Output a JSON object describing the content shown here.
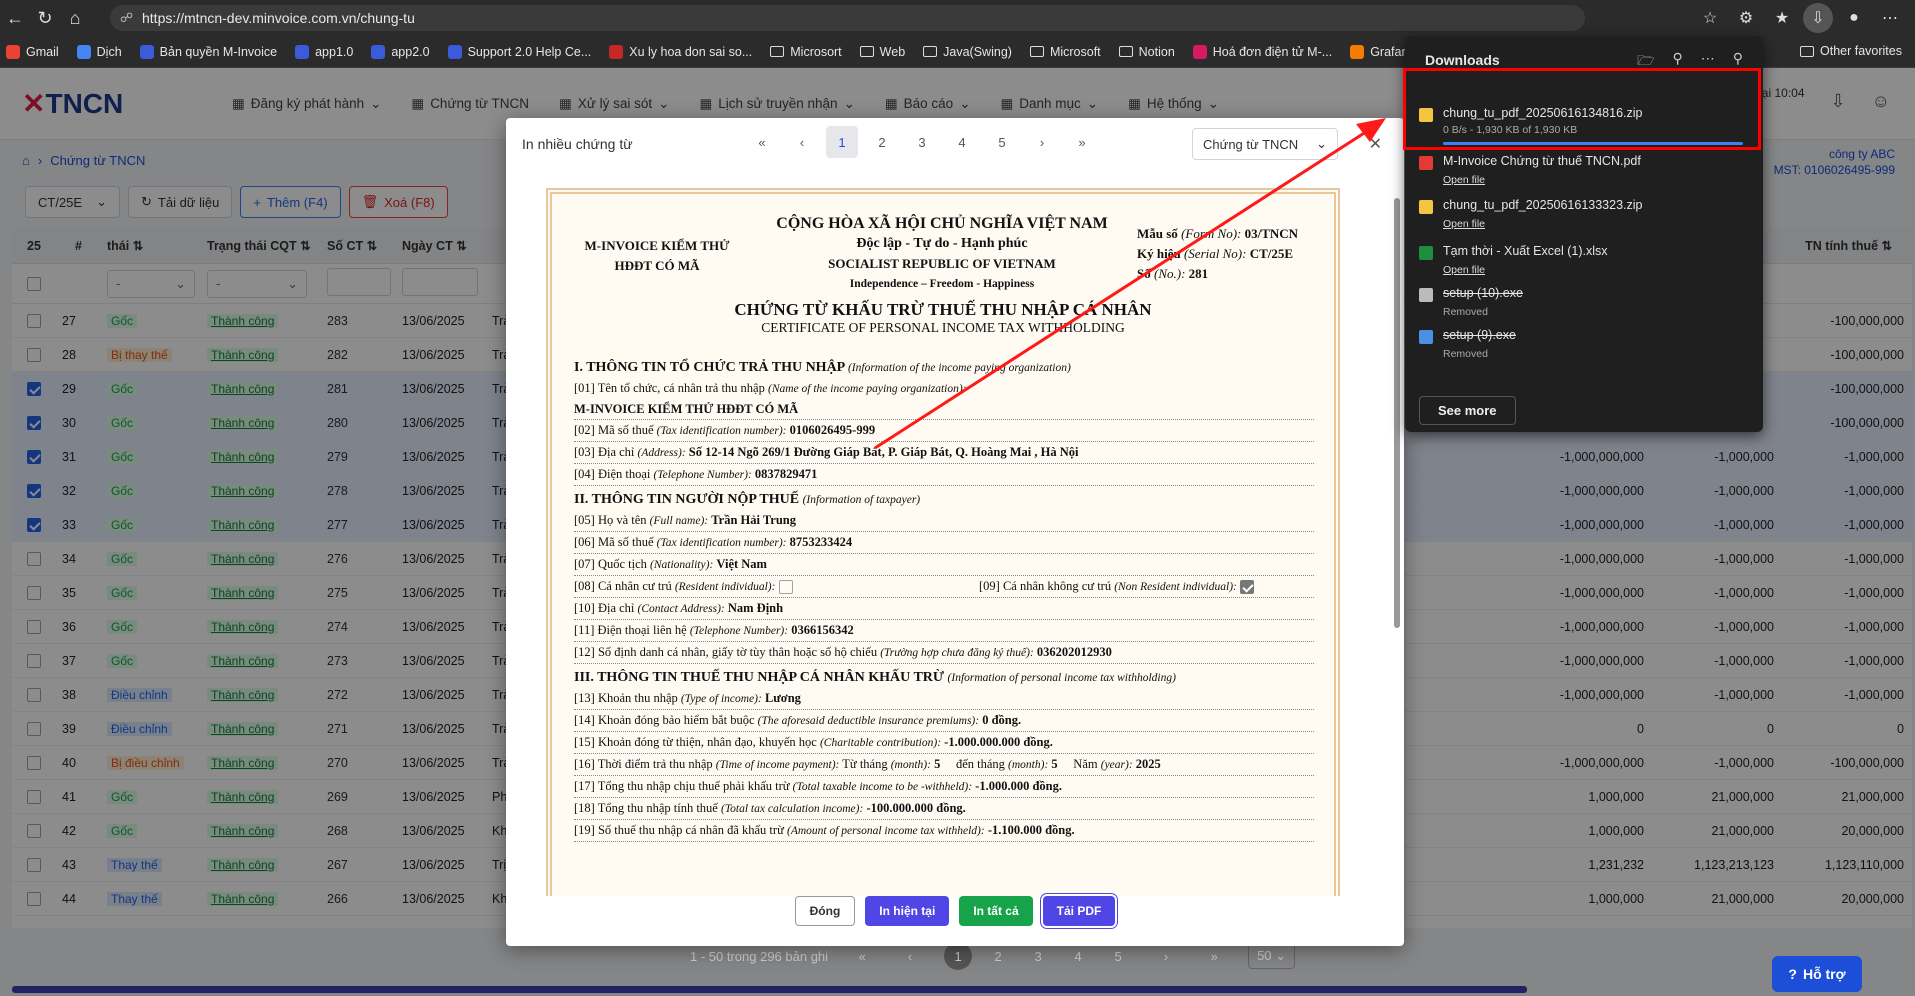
{
  "browser": {
    "url": "https://mtncn-dev.minvoice.com.vn/chung-tu",
    "bookmarks": [
      "Gmail",
      "Dịch",
      "Bản quyền M-Invoice",
      "app1.0",
      "app2.0",
      "Support 2.0 Help Ce...",
      "Xu ly hoa don sai so...",
      "Microsort",
      "Web",
      "Java(Swing)",
      "Microsoft",
      "Notion",
      "Hoá đơn điện tử M-...",
      "Grafana"
    ],
    "other_favorites": "Other favorites"
  },
  "app": {
    "logo": "TNCN",
    "menu": [
      "Đăng ký phát hành",
      "Chứng từ TNCN",
      "Xử lý sai sót",
      "Lịch sử truyền nhận",
      "Báo cáo",
      "Danh mục",
      "Hệ thống"
    ],
    "breadcrumb": "Chứng từ TNCN",
    "header_right_text": "n lại 10:04",
    "header_right_sub": "6",
    "company": "công ty ABC",
    "mst": "MST: 0106026495-999",
    "serial_select": "CT/25E",
    "toolbar": {
      "refresh": "Tải dữ liệu",
      "add": "Thêm (F4)",
      "delete": "Xoá (F8)"
    },
    "page_size_header": "25",
    "columns": {
      "idx": "#",
      "status": "thái",
      "cqt": "Trạng thái CQT",
      "so_ct": "Số CT",
      "ngay_ct": "Ngày CT",
      "tn_tinh_thue": "TN tính thuế"
    },
    "filter_placeholder": "-",
    "rows": [
      {
        "n": "27",
        "status": "Gốc",
        "st": "goc",
        "cqt": "Thành công",
        "so": "283",
        "date": "13/06/2025",
        "t": "Trả",
        "sel": false,
        "v1": "",
        "v2": "",
        "v3": "-100,000,000"
      },
      {
        "n": "28",
        "status": "Bị thay thế",
        "st": "thay",
        "cqt": "Thành công",
        "so": "282",
        "date": "13/06/2025",
        "t": "Trả",
        "sel": false,
        "v1": "",
        "v2": "",
        "v3": "-100,000,000"
      },
      {
        "n": "29",
        "status": "Gốc",
        "st": "goc",
        "cqt": "Thành công",
        "so": "281",
        "date": "13/06/2025",
        "t": "Trả",
        "sel": true,
        "v1": "",
        "v2": "",
        "v3": "-100,000,000"
      },
      {
        "n": "30",
        "status": "Gốc",
        "st": "goc",
        "cqt": "Thành công",
        "so": "280",
        "date": "13/06/2025",
        "t": "Trả",
        "sel": true,
        "v1": "",
        "v2": "",
        "v3": "-100,000,000"
      },
      {
        "n": "31",
        "status": "Gốc",
        "st": "goc",
        "cqt": "Thành công",
        "so": "279",
        "date": "13/06/2025",
        "t": "Trả",
        "sel": true,
        "v1": "-1,000,000,000",
        "v2": "-1,000,000",
        "v3": "-1,000,000"
      },
      {
        "n": "32",
        "status": "Gốc",
        "st": "goc",
        "cqt": "Thành công",
        "so": "278",
        "date": "13/06/2025",
        "t": "Trả",
        "sel": true,
        "v1": "-1,000,000,000",
        "v2": "-1,000,000",
        "v3": "-1,000,000"
      },
      {
        "n": "33",
        "status": "Gốc",
        "st": "goc",
        "cqt": "Thành công",
        "so": "277",
        "date": "13/06/2025",
        "t": "Trả",
        "sel": true,
        "v1": "-1,000,000,000",
        "v2": "-1,000,000",
        "v3": "-1,000,000"
      },
      {
        "n": "34",
        "status": "Gốc",
        "st": "goc",
        "cqt": "Thành công",
        "so": "276",
        "date": "13/06/2025",
        "t": "Trả",
        "sel": false,
        "v1": "-1,000,000,000",
        "v2": "-1,000,000",
        "v3": "-1,000,000"
      },
      {
        "n": "35",
        "status": "Gốc",
        "st": "goc",
        "cqt": "Thành công",
        "so": "275",
        "date": "13/06/2025",
        "t": "Trả",
        "sel": false,
        "v1": "-1,000,000,000",
        "v2": "-1,000,000",
        "v3": "-1,000,000"
      },
      {
        "n": "36",
        "status": "Gốc",
        "st": "goc",
        "cqt": "Thành công",
        "so": "274",
        "date": "13/06/2025",
        "t": "Trả",
        "sel": false,
        "v1": "-1,000,000,000",
        "v2": "-1,000,000",
        "v3": "-1,000,000"
      },
      {
        "n": "37",
        "status": "Gốc",
        "st": "goc",
        "cqt": "Thành công",
        "so": "273",
        "date": "13/06/2025",
        "t": "Trả",
        "sel": false,
        "v1": "-1,000,000,000",
        "v2": "-1,000,000",
        "v3": "-1,000,000"
      },
      {
        "n": "38",
        "status": "Điều chỉnh",
        "st": "dc",
        "cqt": "Thành công",
        "so": "272",
        "date": "13/06/2025",
        "t": "Trả",
        "sel": false,
        "v1": "-1,000,000,000",
        "v2": "-1,000,000",
        "v3": "-1,000,000"
      },
      {
        "n": "39",
        "status": "Điều chỉnh",
        "st": "dc",
        "cqt": "Thành công",
        "so": "271",
        "date": "13/06/2025",
        "t": "Trả",
        "sel": false,
        "v1": "0",
        "v2": "0",
        "v3": "0"
      },
      {
        "n": "40",
        "status": "Bị điều chỉnh",
        "st": "thay",
        "cqt": "Thành công",
        "so": "270",
        "date": "13/06/2025",
        "t": "Trả",
        "sel": false,
        "v1": "-1,000,000,000",
        "v2": "-1,000,000",
        "v3": "-100,000,000"
      },
      {
        "n": "41",
        "status": "Gốc",
        "st": "goc",
        "cqt": "Thành công",
        "so": "269",
        "date": "13/06/2025",
        "t": "Phả",
        "sel": false,
        "v1": "1,000,000",
        "v2": "21,000,000",
        "v3": "21,000,000"
      },
      {
        "n": "42",
        "status": "Gốc",
        "st": "goc",
        "cqt": "Thành công",
        "so": "268",
        "date": "13/06/2025",
        "t": "Khi",
        "sel": false,
        "v1": "1,000,000",
        "v2": "21,000,000",
        "v3": "20,000,000"
      },
      {
        "n": "43",
        "status": "Thay thế",
        "st": "dc",
        "cqt": "Thành công",
        "so": "267",
        "date": "13/06/2025",
        "t": "Trị",
        "sel": false,
        "v1": "1,231,232",
        "v2": "1,123,213,123",
        "v3": "1,123,110,000"
      },
      {
        "n": "44",
        "status": "Thay thế",
        "st": "dc",
        "cqt": "Thành công",
        "so": "266",
        "date": "13/06/2025",
        "t": "Khi",
        "sel": false,
        "v1": "1,000,000",
        "v2": "21,000,000",
        "v3": "20,000,000"
      }
    ],
    "bottom_pager": {
      "info": "1 - 50 trong 296 bản ghi",
      "pages": [
        "1",
        "2",
        "3",
        "4",
        "5"
      ],
      "size": "50"
    },
    "support": "Hỗ trợ"
  },
  "modal": {
    "title": "In nhiều chứng từ",
    "pages": [
      "1",
      "2",
      "3",
      "4",
      "5"
    ],
    "select": "Chứng từ TNCN",
    "buttons": {
      "close": "Đóng",
      "print_current": "In hiện tại",
      "print_all": "In tất cả",
      "download_pdf": "Tải PDF"
    },
    "cert": {
      "org_left": "M-INVOICE KIỂM THỬ HĐĐT CÓ MÃ",
      "nation": "CỘNG HÒA XÃ HỘI CHỦ NGHĨA VIỆT NAM",
      "motto": "Độc lập - Tự do - Hạnh phúc",
      "nation_en": "SOCIALIST REPUBLIC OF VIETNAM",
      "motto_en": "Independence – Freedom - Happiness",
      "mau_so_label": "Mẫu số",
      "mau_so_en": "(Form No):",
      "mau_so": "03/TNCN",
      "ky_hieu_label": "Ký hiệu",
      "ky_hieu_en": "(Serial No):",
      "ky_hieu": "CT/25E",
      "so_label": "Số",
      "so_en": "(No.):",
      "so": "281",
      "title": "CHỨNG TỪ KHẤU TRỪ THUẾ THU NHẬP CÁ NHÂN",
      "title_en": "CERTIFICATE OF PERSONAL INCOME TAX WITHHOLDING",
      "sec1": "I. THÔNG TIN TỔ CHỨC TRẢ THU NHẬP",
      "sec1_en": "(Information of the income paying organization)",
      "l01": "[01] Tên tổ chức, cá nhân trả thu nhập",
      "l01_en": "(Name of the income paying organization):",
      "org_name": "M-INVOICE KIỂM THỬ HĐĐT CÓ MÃ",
      "l02": "[02] Mã số thuế",
      "l02_en": "(Tax identification number):",
      "l02_v": "0106026495-999",
      "l03": "[03] Địa chỉ",
      "l03_en": "(Address):",
      "l03_v": "Số 12-14 Ngõ 269/1 Đường Giáp Bát, P. Giáp Bát, Q. Hoàng Mai , Hà Nội",
      "l04": "[04] Điện thoại",
      "l04_en": "(Telephone Number):",
      "l04_v": "0837829471",
      "sec2": "II. THÔNG TIN NGƯỜI NỘP THUẾ",
      "sec2_en": "(Information of taxpayer)",
      "l05": "[05] Họ và tên",
      "l05_en": "(Full name):",
      "l05_v": "Trần Hải Trung",
      "l06": "[06] Mã số thuế",
      "l06_en": "(Tax identification number):",
      "l06_v": "8753233424",
      "l07": "[07] Quốc tịch",
      "l07_en": "(Nationality):",
      "l07_v": "Việt Nam",
      "l08": "[08] Cá nhân cư trú",
      "l08_en": "(Resident individual):",
      "l09": "[09] Cá nhân không cư trú",
      "l09_en": "(Non Resident individual):",
      "l10": "[10] Địa chỉ",
      "l10_en": "(Contact Address):",
      "l10_v": "Nam Định",
      "l11": "[11] Điện thoại liên hệ",
      "l11_en": "(Telephone Number):",
      "l11_v": "0366156342",
      "l12": "[12] Số định danh cá nhân, giấy tờ tùy thân hoặc số hộ chiếu",
      "l12_en": "(Trường hợp chưa đăng ký thuế):",
      "l12_v": "036202012930",
      "sec3": "III. THÔNG TIN THUẾ THU NHẬP CÁ NHÂN KHẤU TRỪ",
      "sec3_en": "(Information of personal income tax withholding)",
      "l13": "[13] Khoản thu nhập",
      "l13_en": "(Type of income):",
      "l13_v": "Lương",
      "l14": "[14] Khoản đóng bảo hiểm bắt buộc",
      "l14_en": "(The aforesaid deductible insurance premiums):",
      "l14_v": "0 đồng.",
      "l15": "[15] Khoản đóng từ thiện, nhân đạo, khuyến học",
      "l15_en": "(Charitable contribution):",
      "l15_v": "-1.000.000.000 đồng.",
      "l16": "[16] Thời điểm trả thu nhập",
      "l16_en": "(Time of income payment):",
      "l16_from": "Từ tháng",
      "l16_month_en": "(month):",
      "l16_from_v": "5",
      "l16_to": "đến tháng",
      "l16_to_v": "5",
      "l16_year": "Năm",
      "l16_year_en": "(year):",
      "l16_year_v": "2025",
      "l17": "[17] Tổng thu nhập chịu thuế phải khấu trừ",
      "l17_en": "(Total taxable income to be -withheld):",
      "l17_v": "-1.000.000 đồng.",
      "l18": "[18] Tổng thu nhập tính thuế",
      "l18_en": "(Total tax calculation income):",
      "l18_v": "-100.000.000 đồng.",
      "l19": "[19] Số thuế thu nhập cá nhân đã khấu trừ",
      "l19_en": "(Amount of personal income tax withheld):",
      "l19_v": "-1.100.000 đồng."
    }
  },
  "downloads": {
    "title": "Downloads",
    "items": [
      {
        "name": "chung_tu_pdf_20250616134816.zip",
        "sub": "0 B/s - 1,930 KB of 1,930 KB",
        "kind": "progress",
        "color": "#f5c542"
      },
      {
        "name": "M-Invoice Chứng từ thuế TNCN.pdf",
        "sub": "Open file",
        "kind": "link",
        "color": "#e53935"
      },
      {
        "name": "chung_tu_pdf_20250616133323.zip",
        "sub": "Open file",
        "kind": "link",
        "color": "#f5c542"
      },
      {
        "name": "Tạm thời - Xuất Excel (1).xlsx",
        "sub": "Open file",
        "kind": "link",
        "color": "#1e8e3e"
      },
      {
        "name": "setup (10).exe",
        "sub": "Removed",
        "kind": "removed",
        "color": "#bbbbbb"
      },
      {
        "name": "setup (9).exe",
        "sub": "Removed",
        "kind": "removed",
        "color": "#4a90e2"
      }
    ],
    "see_more": "See more"
  },
  "colors": {
    "annotation_red": "#ff0000",
    "primary": "#4f46e5"
  }
}
